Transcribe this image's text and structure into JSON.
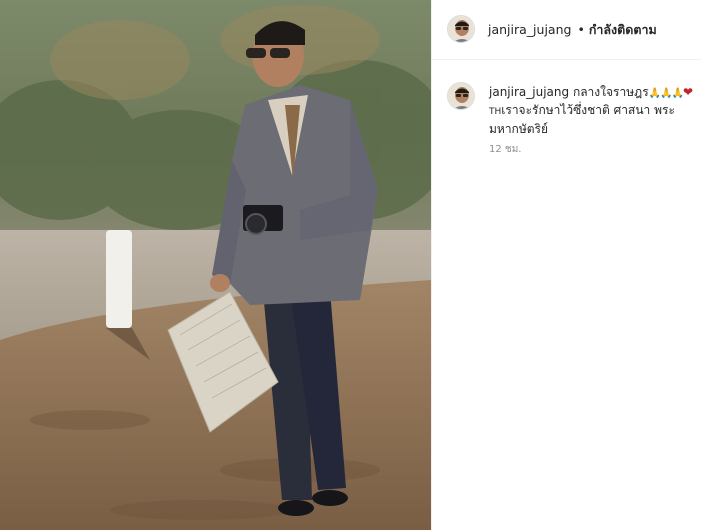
{
  "post": {
    "author": "janjira_jujang",
    "follow_status": "กำลังติดตาม",
    "separator": "•"
  },
  "caption": {
    "username": "janjira_jujang",
    "text_line1": "กลางใจราษฎร",
    "emojis": "🙏🙏🙏",
    "heart": "❤",
    "flag_text": "TH",
    "text_rest": "เราจะรักษาไว้ซึ่งชาติ ศาสนา พระมหากษัตริย์",
    "timestamp": "12 ชม."
  },
  "photo": {
    "subject": "man in grey suit carrying camera and map, outdoors on dirt ground"
  },
  "colors": {
    "border": "#efefef",
    "text": "#262626",
    "muted": "#8e8e8e",
    "heart": "#c0252b"
  }
}
